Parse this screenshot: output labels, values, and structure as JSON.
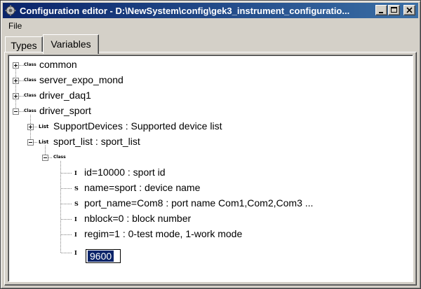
{
  "window": {
    "title": "Configuration editor - D:\\NewSystem\\config\\gek3_instrument_configuratio...",
    "colors": {
      "title_start": "#0a246a",
      "title_end": "#3a6ea5",
      "face": "#d4d0c8",
      "selection": "#0a246a"
    },
    "icons": {
      "app": "gear-app-icon",
      "minimize": "minimize-icon",
      "maximize": "maximize-icon",
      "close": "close-icon"
    }
  },
  "menu": {
    "file": "File"
  },
  "tabs": [
    {
      "label": "Types",
      "active": false
    },
    {
      "label": "Variables",
      "active": true
    }
  ],
  "tree": {
    "roots": [
      {
        "tag": "Class",
        "label": "common",
        "expanded": false
      },
      {
        "tag": "Class",
        "label": "server_expo_mond",
        "expanded": false
      },
      {
        "tag": "Class",
        "label": "driver_daq1",
        "expanded": false
      },
      {
        "tag": "Class",
        "label": "driver_sport",
        "expanded": true
      }
    ],
    "driver_sport_children": [
      {
        "tag": "List",
        "label": "SupportDevices : Supported device list",
        "expanded": false
      },
      {
        "tag": "List",
        "label": "sport_list : sport_list",
        "expanded": true
      }
    ],
    "sport_list_children": [
      {
        "tag": "Class",
        "expanded": true
      }
    ],
    "fields": [
      {
        "type": "I",
        "label": "id=10000 : sport id"
      },
      {
        "type": "S",
        "label": "name=sport : device name"
      },
      {
        "type": "S",
        "label": "port_name=Com8 : port name  Com1,Com2,Com3 ..."
      },
      {
        "type": "I",
        "label": "nblock=0 : block number"
      },
      {
        "type": "I",
        "label": "regim=1 : 0-test mode, 1-work mode"
      }
    ],
    "edit_field": {
      "type": "I",
      "value": "9600"
    }
  }
}
